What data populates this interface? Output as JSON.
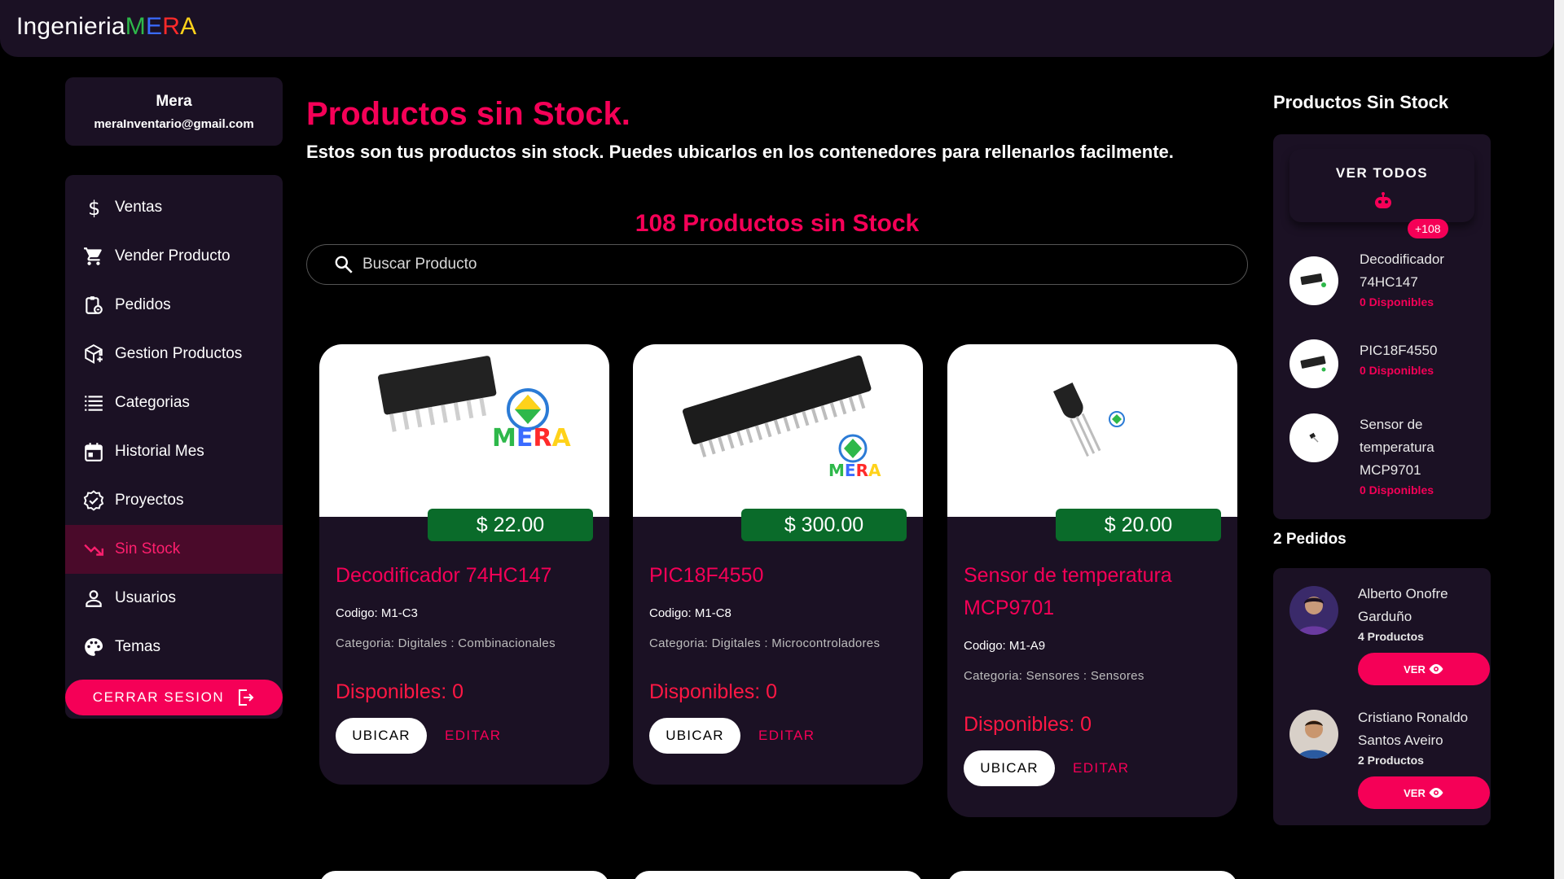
{
  "brand": {
    "prefix": "Ingenieria",
    "m": "M",
    "e": "E",
    "r": "R",
    "a": "A"
  },
  "user": {
    "name": "Mera",
    "email": "meraInventario@gmail.com"
  },
  "nav": {
    "items": [
      {
        "label": "Ventas",
        "icon": "dollar-icon"
      },
      {
        "label": "Vender Producto",
        "icon": "cart-icon"
      },
      {
        "label": "Pedidos",
        "icon": "clipboard-icon"
      },
      {
        "label": "Gestion Productos",
        "icon": "box-add-icon"
      },
      {
        "label": "Categorias",
        "icon": "list-icon"
      },
      {
        "label": "Historial Mes",
        "icon": "calendar-icon"
      },
      {
        "label": "Proyectos",
        "icon": "verified-icon"
      },
      {
        "label": "Sin Stock",
        "icon": "trending-down-icon"
      },
      {
        "label": "Usuarios",
        "icon": "person-icon"
      },
      {
        "label": "Temas",
        "icon": "palette-icon"
      }
    ],
    "active": "Sin Stock",
    "logout_label": "CERRAR SESION"
  },
  "main": {
    "title": "Productos sin Stock.",
    "subtitle": "Estos son tus productos sin stock. Puedes ubicarlos en los contenedores para rellenarlos facilmente.",
    "count_title": "108 Productos sin Stock",
    "search_placeholder": "Buscar Producto"
  },
  "products": [
    {
      "name": "Decodificador 74HC147",
      "price": "$ 22.00",
      "code": "Codigo: M1-C3",
      "category": "Categoria: Digitales : Combinacionales",
      "available": "Disponibles: 0",
      "ubicar": "UBICAR",
      "editar": "EDITAR"
    },
    {
      "name": "PIC18F4550",
      "price": "$ 300.00",
      "code": "Codigo: M1-C8",
      "category": "Categoria: Digitales : Microcontroladores",
      "available": "Disponibles: 0",
      "ubicar": "UBICAR",
      "editar": "EDITAR"
    },
    {
      "name": "Sensor de temperatura MCP9701",
      "price": "$ 20.00",
      "code": "Codigo: M1-A9",
      "category": "Categoria: Sensores : Sensores",
      "available": "Disponibles: 0",
      "ubicar": "UBICAR",
      "editar": "EDITAR"
    }
  ],
  "right": {
    "title": "Productos Sin Stock",
    "ver_todos": "VER TODOS",
    "badge": "+108",
    "items": [
      {
        "name": "Decodificador 74HC147",
        "available": "0 Disponibles"
      },
      {
        "name": "PIC18F4550",
        "available": "0 Disponibles"
      },
      {
        "name": "Sensor de temperatura MCP9701",
        "available": "0 Disponibles"
      }
    ],
    "orders_title": "2 Pedidos",
    "orders": [
      {
        "name": "Alberto Onofre Garduño",
        "count": "4 Productos",
        "button": "VER"
      },
      {
        "name": "Cristiano Ronaldo Santos Aveiro",
        "count": "2 Productos",
        "button": "VER"
      }
    ]
  },
  "colors": {
    "accent": "#f50057",
    "panel": "#1b1124",
    "price": "#0a6b2a",
    "background": "#000000"
  }
}
